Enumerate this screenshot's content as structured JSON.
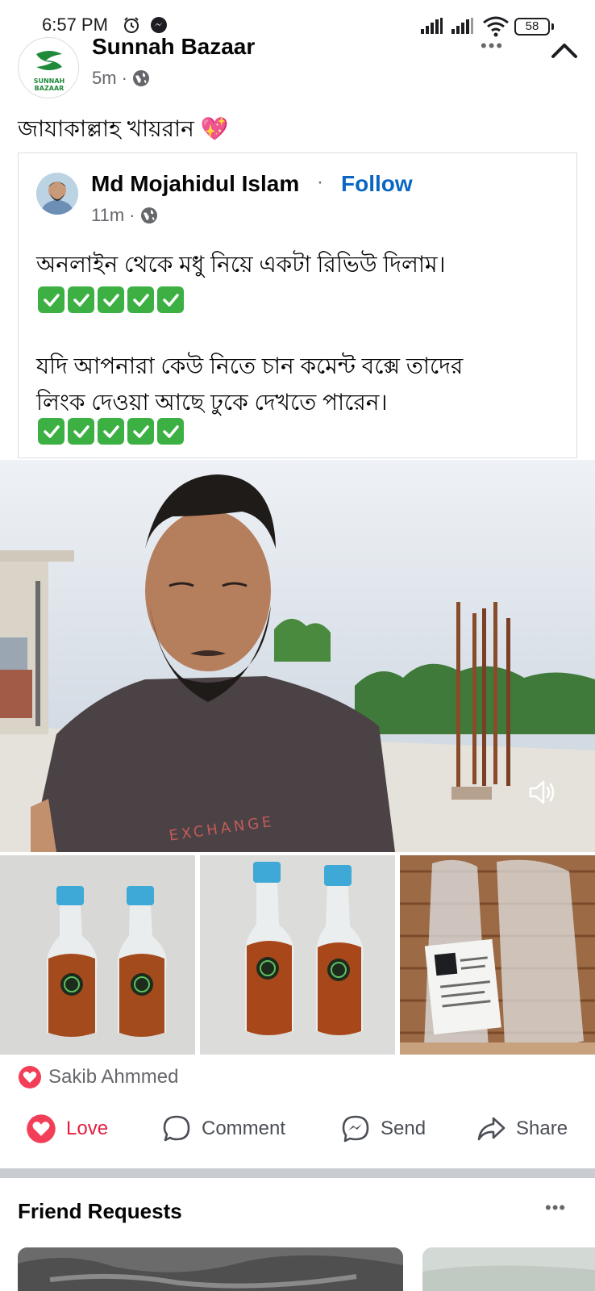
{
  "status_bar": {
    "time": "6:57 PM",
    "battery": "58"
  },
  "post": {
    "page_name": "Sunnah Bazaar",
    "logo_text": "SUNNAH BAZAAR",
    "time_ago": "5m",
    "time_sep": "·",
    "caption": "জাযাকাল্লাহ খায়রান 💖"
  },
  "shared": {
    "author": "Md Mojahidul Islam",
    "dot": "·",
    "follow": "Follow",
    "time_ago": "11m",
    "time_sep": "·",
    "line1": "অনলাইন থেকে মধু নিয়ে একটা রিভিউ দিলাম।",
    "line2": "যদি আপনারা কেউ নিতে চান কমেন্ট বক্সে তাদের",
    "line3": "লিংক দেওয়া আছে ঢুকে দেখতে পারেন।",
    "checks_count": 5
  },
  "media": {
    "shirt_text": "EXCHANGE"
  },
  "reactions": {
    "reactor": "Sakib Ahmmed"
  },
  "actions": {
    "love": "Love",
    "comment": "Comment",
    "send": "Send",
    "share": "Share"
  },
  "friend_requests": {
    "title": "Friend Requests"
  },
  "colors": {
    "accent": "#0a66c2",
    "love": "#e41e3f",
    "check": "#3cb043"
  }
}
